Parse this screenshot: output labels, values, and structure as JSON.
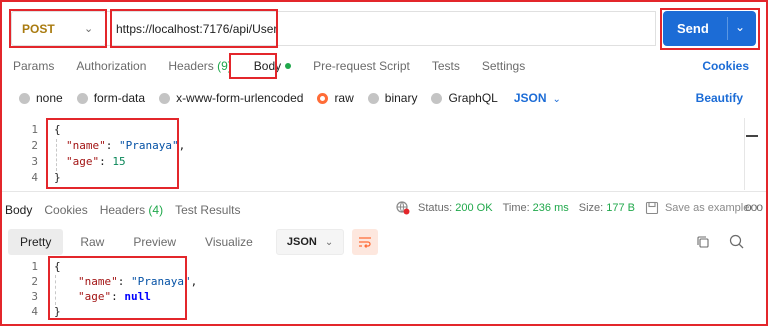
{
  "request": {
    "method": "POST",
    "url": "https://localhost:7176/api/User",
    "send_label": "Send"
  },
  "request_tabs": [
    {
      "label": "Params"
    },
    {
      "label": "Authorization"
    },
    {
      "label": "Headers",
      "count": "(9)"
    },
    {
      "label": "Body"
    },
    {
      "label": "Pre-request Script"
    },
    {
      "label": "Tests"
    },
    {
      "label": "Settings"
    }
  ],
  "cookies_label": "Cookies",
  "body_types": [
    "none",
    "form-data",
    "x-www-form-urlencoded",
    "raw",
    "binary",
    "GraphQL"
  ],
  "body_format": "JSON",
  "beautify_label": "Beautify",
  "request_body": {
    "line_numbers": [
      "1",
      "2",
      "3",
      "4"
    ],
    "open": "{",
    "name_key": "\"name\"",
    "name_value": "\"Pranaya\"",
    "age_key": "\"age\"",
    "age_value": "15",
    "close": "}"
  },
  "response_tabs": [
    {
      "label": "Body"
    },
    {
      "label": "Cookies"
    },
    {
      "label": "Headers",
      "count": "(4)"
    },
    {
      "label": "Test Results"
    }
  ],
  "response_status": {
    "status_label": "Status:",
    "status_value": "200 OK",
    "time_label": "Time:",
    "time_value": "236 ms",
    "size_label": "Size:",
    "size_value": "177 B",
    "save_label": "Save as example",
    "more_label": "ooo"
  },
  "view_tabs": [
    "Pretty",
    "Raw",
    "Preview",
    "Visualize"
  ],
  "response_format": "JSON",
  "response_body": {
    "line_numbers": [
      "1",
      "2",
      "3",
      "4"
    ],
    "open": "{",
    "name_key": "\"name\"",
    "name_value": "\"Pranaya\"",
    "age_key": "\"age\"",
    "age_value": "null",
    "close": "}"
  },
  "colors": {
    "accent_orange": "#ff6c37",
    "send_blue": "#1c6cd6",
    "highlight_red": "#e3262b",
    "status_green": "#20a84b"
  }
}
